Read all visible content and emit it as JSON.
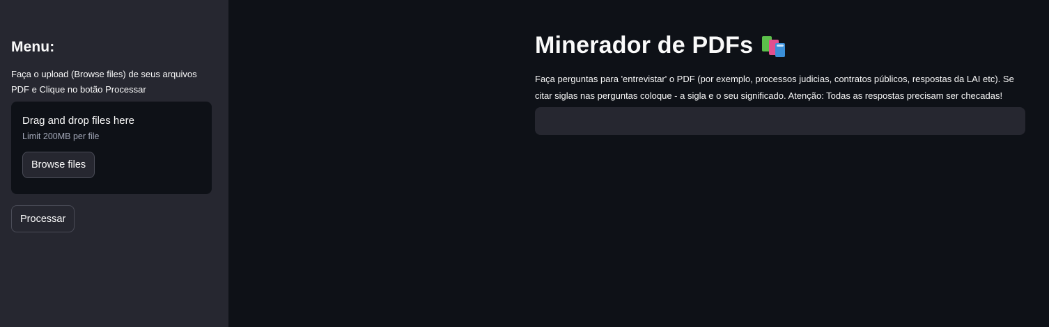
{
  "sidebar": {
    "title": "Menu:",
    "description": "Faça o upload (Browse files) de seus arquivos PDF e Clique no botão Processar",
    "uploader": {
      "drop_title": "Drag and drop files here",
      "limit": "Limit 200MB per file",
      "browse_label": "Browse files"
    },
    "process_label": "Processar"
  },
  "main": {
    "title": "Minerador de PDFs",
    "title_icon": "books-icon",
    "description": "Faça perguntas para 'entrevistar' o PDF (por exemplo, processos judicias, contratos públicos, respostas da LAI etc). Se citar siglas nas perguntas coloque - a sigla e o seu significado. Atenção: Todas as respostas precisam ser checadas!",
    "question_input": {
      "value": "",
      "placeholder": ""
    }
  },
  "colors": {
    "background": "#0e1117",
    "sidebar_background": "#262730",
    "text": "#fafafa"
  }
}
